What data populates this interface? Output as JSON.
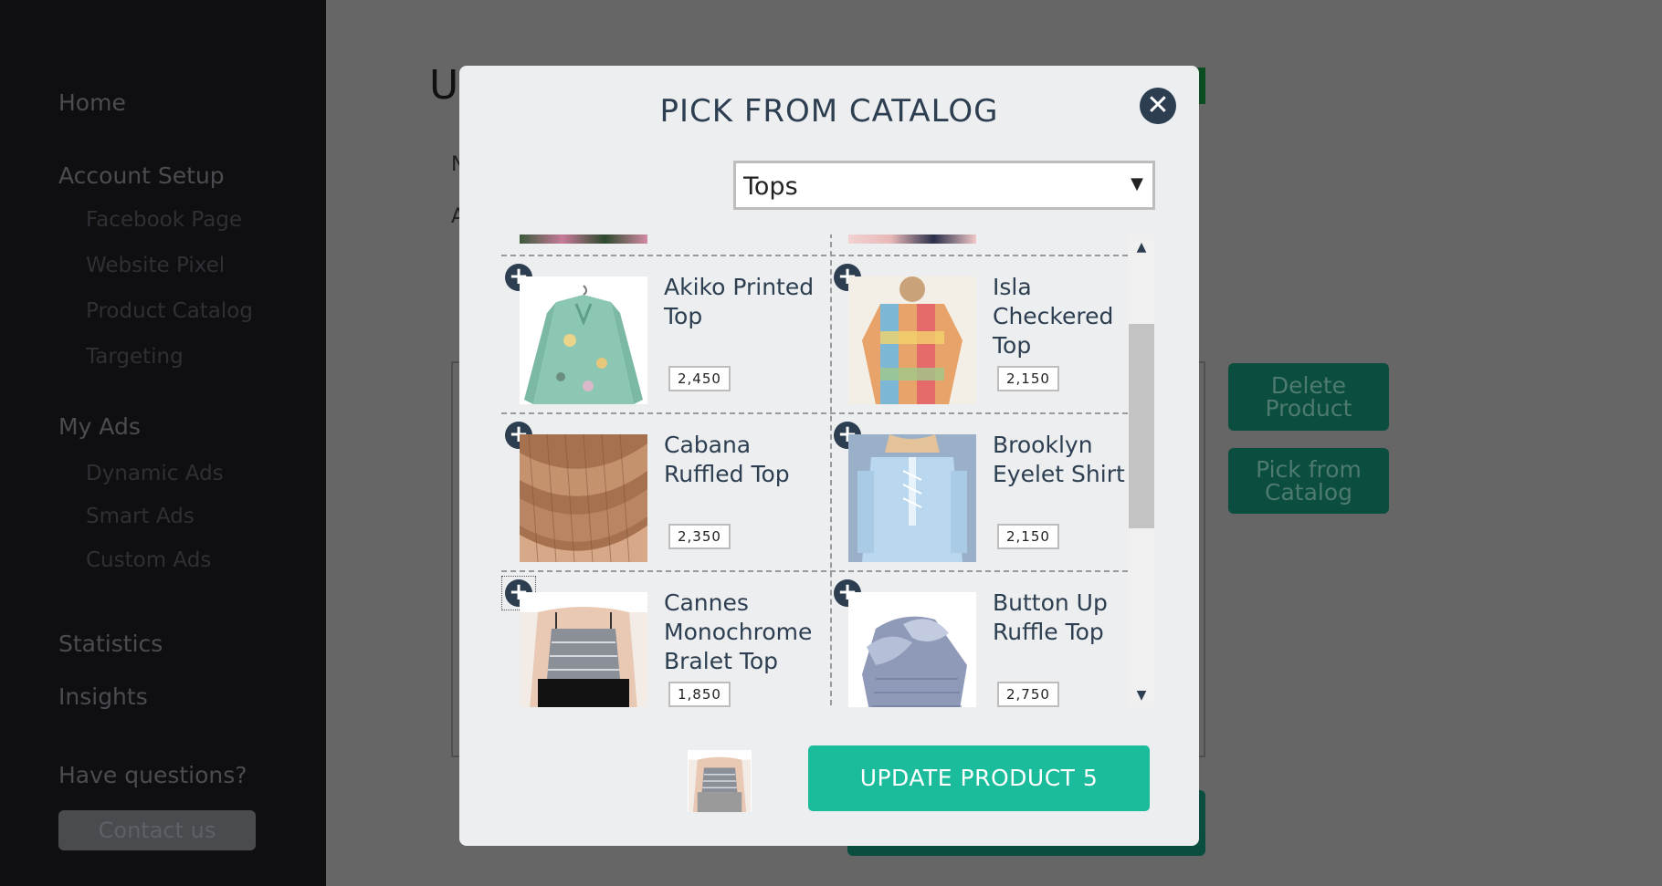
{
  "sidebar": {
    "home": "Home",
    "account_setup": "Account Setup",
    "account_items": [
      "Facebook Page",
      "Website Pixel",
      "Product Catalog",
      "Targeting"
    ],
    "my_ads": "My Ads",
    "ads_items": [
      "Dynamic Ads",
      "Smart Ads",
      "Custom Ads"
    ],
    "statistics": "Statistics",
    "insights": "Insights",
    "questions": "Have questions?",
    "contact": "Contact us"
  },
  "background": {
    "title_fragment": "U",
    "letter_n": "N",
    "letter_a": "A",
    "delete_button": "Delete Product",
    "pick_button": "Pick from Catalog"
  },
  "modal": {
    "title": "PICK FROM CATALOG",
    "close_icon": "close-icon",
    "category_select": {
      "value": "Tops"
    },
    "products": [
      {
        "name": "Akiko Printed Top",
        "price": "2,450"
      },
      {
        "name": "Isla Checkered Top",
        "price": "2,150"
      },
      {
        "name": "Cabana Ruffled Top",
        "price": "2,350"
      },
      {
        "name": "Brooklyn Eyelet Shirt",
        "price": "2,150"
      },
      {
        "name": "Cannes Monochrome Bralet Top",
        "price": "1,850"
      },
      {
        "name": "Button Up Ruffle Top",
        "price": "2,750"
      }
    ],
    "update_button": "UPDATE PRODUCT 5"
  },
  "colors": {
    "accent": "#1abc9c",
    "heading": "#2c3e50",
    "sidebar_bg": "#0f0f12",
    "overlay": "#666666"
  }
}
